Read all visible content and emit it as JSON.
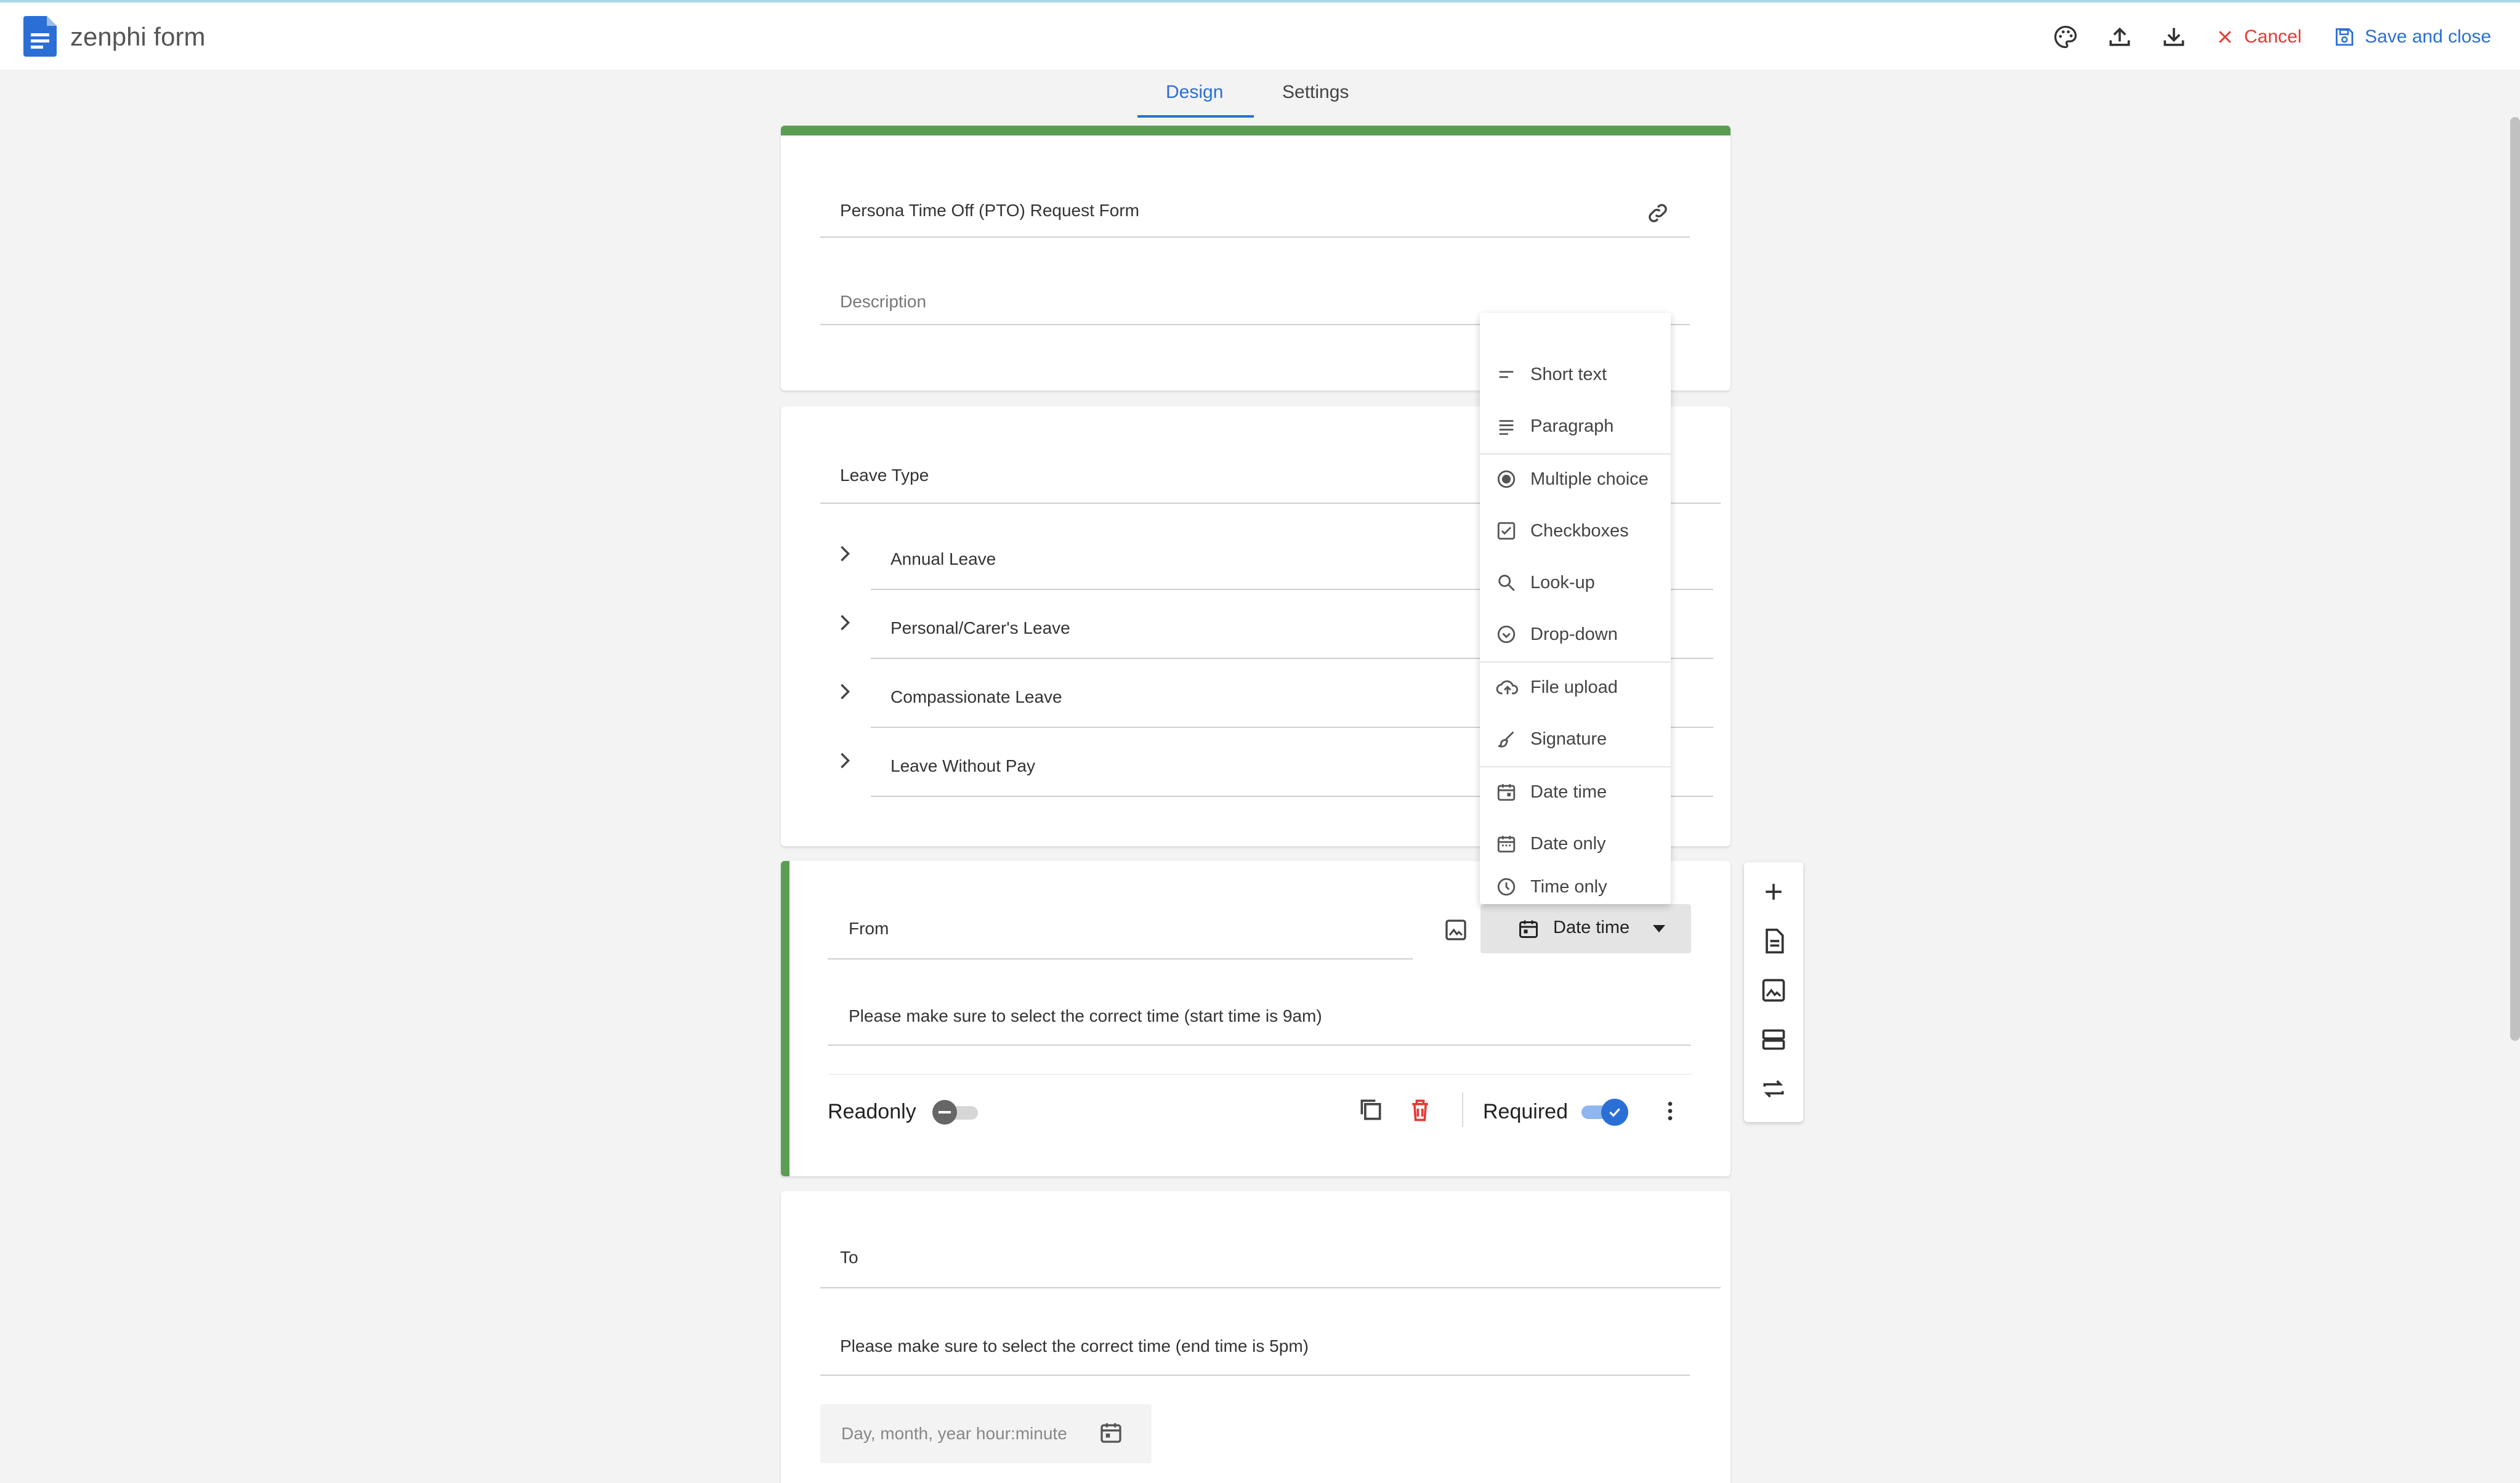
{
  "app": {
    "name": "zenphi form"
  },
  "header": {
    "cancel_label": "Cancel",
    "save_label": "Save and close"
  },
  "tabs": [
    {
      "label": "Design",
      "active": true
    },
    {
      "label": "Settings",
      "active": false
    }
  ],
  "form": {
    "title": "Persona Time Off (PTO) Request Form",
    "description_placeholder": "Description"
  },
  "leave_type": {
    "label": "Leave Type",
    "options": [
      "Annual Leave",
      "Personal/Carer's Leave",
      "Compassionate Leave",
      "Leave Without Pay"
    ]
  },
  "from_field": {
    "label": "From",
    "type_button": "Date time",
    "help": "Please make sure to select the correct time (start time is 9am)",
    "readonly_label": "Readonly",
    "required_label": "Required"
  },
  "to_field": {
    "label": "To",
    "help": "Please make sure to select the correct time (end time is 5pm)",
    "input_placeholder": "Day, month, year hour:minute"
  },
  "type_menu": {
    "items": [
      "Short text",
      "Paragraph",
      "Multiple choice",
      "Checkboxes",
      "Look-up",
      "Drop-down",
      "File upload",
      "Signature",
      "Date time",
      "Date only",
      "Time only"
    ]
  },
  "colors": {
    "accent": "#2b6fd6",
    "card_bar": "#5a9e54",
    "danger": "#e53935"
  }
}
